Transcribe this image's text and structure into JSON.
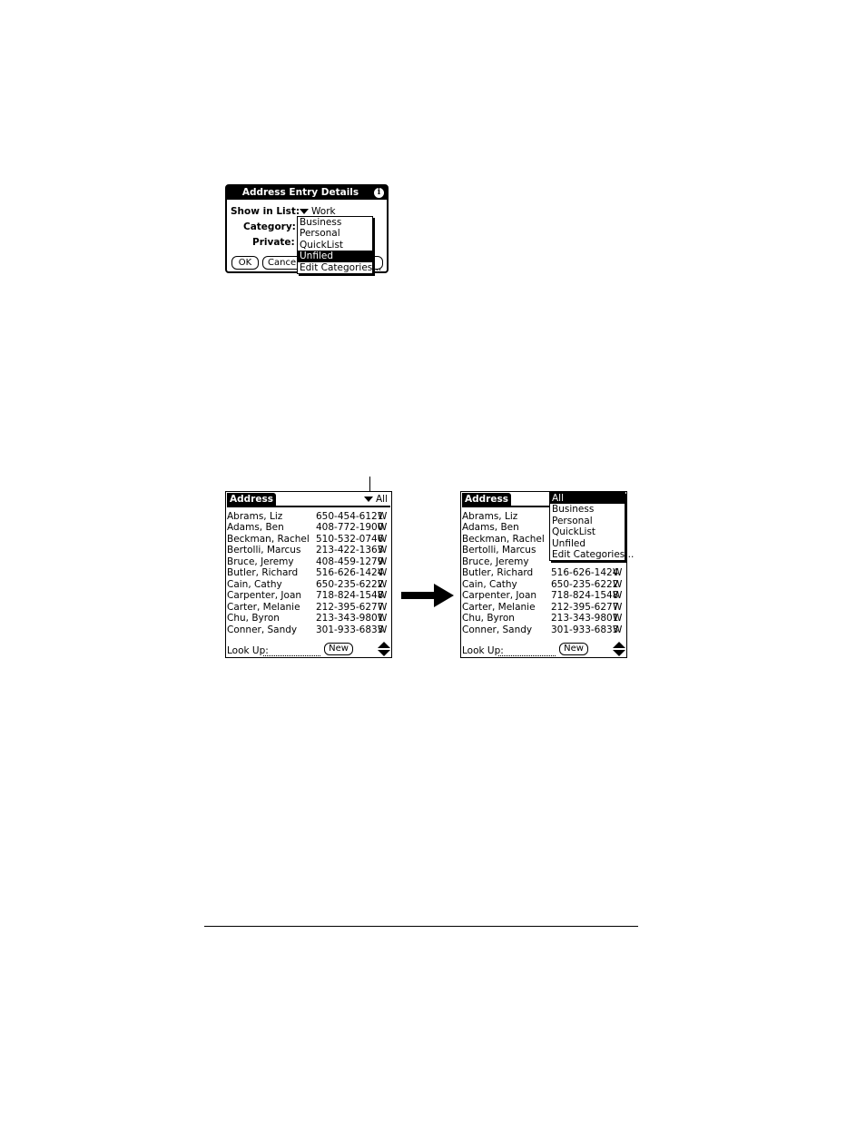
{
  "details_dialog": {
    "title": "Address Entry Details",
    "show_in_list_label": "Show in List:",
    "show_in_list_value": "Work",
    "category_label": "Category:",
    "private_label": "Private:",
    "ok_label": "OK",
    "cancel_label": "Cancel",
    "category_menu": [
      {
        "label": "Business",
        "selected": false
      },
      {
        "label": "Personal",
        "selected": false
      },
      {
        "label": "QuickList",
        "selected": false
      },
      {
        "label": "Unfiled",
        "selected": true
      },
      {
        "label": "Edit Categories...",
        "selected": false
      }
    ]
  },
  "address_list_before": {
    "title": "Address",
    "category": "All",
    "rows": [
      {
        "name": "Abrams, Liz",
        "phone": "650-454-6121",
        "type": "W"
      },
      {
        "name": "Adams, Ben",
        "phone": "408-772-1900",
        "type": "W"
      },
      {
        "name": "Beckman, Rachel",
        "phone": "510-532-0746",
        "type": "W"
      },
      {
        "name": "Bertolli, Marcus",
        "phone": "213-422-1363",
        "type": "W"
      },
      {
        "name": "Bruce, Jeremy",
        "phone": "408-459-1279",
        "type": "W"
      },
      {
        "name": "Butler, Richard",
        "phone": "516-626-1424",
        "type": "W"
      },
      {
        "name": "Cain, Cathy",
        "phone": "650-235-6222",
        "type": "W"
      },
      {
        "name": "Carpenter, Joan",
        "phone": "718-824-1548",
        "type": "W"
      },
      {
        "name": "Carter, Melanie",
        "phone": "212-395-6277",
        "type": "W"
      },
      {
        "name": "Chu, Byron",
        "phone": "213-343-9801",
        "type": "W"
      },
      {
        "name": "Conner, Sandy",
        "phone": "301-933-6833",
        "type": "W"
      }
    ],
    "lookup_label": "Look Up:",
    "new_label": "New"
  },
  "address_list_after": {
    "title": "Address",
    "category_menu": [
      {
        "label": "All",
        "selected": true
      },
      {
        "label": "Business",
        "selected": false
      },
      {
        "label": "Personal",
        "selected": false
      },
      {
        "label": "QuickList",
        "selected": false
      },
      {
        "label": "Unfiled",
        "selected": false
      },
      {
        "label": "Edit Categories...",
        "selected": false
      }
    ],
    "rows": [
      {
        "name": "Abrams, Liz",
        "phone": "",
        "type": ""
      },
      {
        "name": "Adams, Ben",
        "phone": "",
        "type": ""
      },
      {
        "name": "Beckman, Rachel",
        "phone": "",
        "type": ""
      },
      {
        "name": "Bertolli, Marcus",
        "phone": "",
        "type": ""
      },
      {
        "name": "Bruce, Jeremy",
        "phone": "",
        "type": ""
      },
      {
        "name": "Butler, Richard",
        "phone": "516-626-1424",
        "type": "W"
      },
      {
        "name": "Cain, Cathy",
        "phone": "650-235-6222",
        "type": "W"
      },
      {
        "name": "Carpenter, Joan",
        "phone": "718-824-1548",
        "type": "W"
      },
      {
        "name": "Carter, Melanie",
        "phone": "212-395-6277",
        "type": "W"
      },
      {
        "name": "Chu, Byron",
        "phone": "213-343-9801",
        "type": "W"
      },
      {
        "name": "Conner, Sandy",
        "phone": "301-933-6833",
        "type": "W"
      }
    ],
    "lookup_label": "Look Up:",
    "new_label": "New"
  }
}
